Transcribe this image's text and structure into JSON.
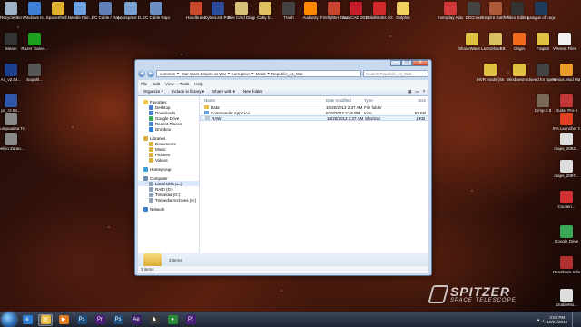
{
  "desktop_icons": [
    {
      "label": "Recycle Bin",
      "color": "#9fb3c8"
    },
    {
      "label": "Windows Is...",
      "color": "#3d7fd6"
    },
    {
      "label": "SpaceShell...",
      "color": "#e0b030"
    },
    {
      "label": "Needle Fair...",
      "color": "#6aa0e0"
    },
    {
      "label": "EC Cable / Rapunz Edit...",
      "color": "#5f7fb5"
    },
    {
      "label": "Aerospace D... Modems 3.7",
      "color": "#7aa0d0"
    },
    {
      "label": "EC Cable Rapunz BGM",
      "color": "#6c8fc0"
    },
    {
      "label": "Handbrake",
      "color": "#c84a2a"
    },
    {
      "label": "CyberLink PowerDVD 12",
      "color": "#2a4a9a"
    },
    {
      "label": "Eve Card Diagram",
      "color": "#d8c27a"
    },
    {
      "label": "Catty b...",
      "color": "#e0c060"
    },
    {
      "label": "Trash",
      "color": "#444"
    },
    {
      "label": "Audacity",
      "color": "#ff8a00"
    },
    {
      "label": "Firefighter Download...",
      "color": "#c6462f"
    },
    {
      "label": "AutoCAD 2013 - Eng...",
      "color": "#c41e2b"
    },
    {
      "label": "SolidWorks 2013 x64...",
      "color": "#d22a2a"
    },
    {
      "label": "Dolphin",
      "color": "#f0d060"
    },
    {
      "label": "Everyday Ajax",
      "color": "#d23a3a"
    },
    {
      "label": "DDO.exe",
      "color": "#444"
    },
    {
      "label": "Empire Earth The Art of C...",
      "color": "#b0583a"
    },
    {
      "label": "Video Editing",
      "color": "#333"
    },
    {
      "label": "League of Legends",
      "color": "#1f3a5a"
    },
    {
      "label": "Steam",
      "color": "#333"
    },
    {
      "label": "Razer Game...",
      "color": "#1da01d"
    },
    {
      "label": "ShockWave Launcher",
      "color": "#e0c040"
    },
    {
      "label": "DxSlowBB",
      "color": "#d8c060"
    },
    {
      "label": "Origin",
      "color": "#f26a1b"
    },
    {
      "label": "Frape2",
      "color": "#e0c040"
    },
    {
      "label": "Veteran Files",
      "color": "#f0f0f0"
    },
    {
      "label": "Ac_v2.54...",
      "color": "#1b3f8c"
    },
    {
      "label": "Sopahl...",
      "color": "#555"
    },
    {
      "label": "MVR mods (Steam)",
      "color": "#e0c040"
    },
    {
      "label": "Windowsmo...",
      "color": "#e0c040"
    },
    {
      "label": "Need for Speed Shi...",
      "color": "#444"
    },
    {
      "label": "Nexus Mod Manager",
      "color": "#e89a2a"
    },
    {
      "label": "pc_r2.54...",
      "color": "#3058a8"
    },
    {
      "label": "Cumpuadsa Tracking",
      "color": "#888"
    },
    {
      "label": "Gimp-2.8",
      "color": "#7a6a55"
    },
    {
      "label": "Guitar Pro 6",
      "color": "#c23838"
    },
    {
      "label": "IFA Launcher Gen",
      "color": "#e04020"
    },
    {
      "label": "Delcio Zaran...",
      "color": "#888"
    },
    {
      "label": "maps_2053...",
      "color": "#ddd"
    },
    {
      "label": "maps_2097...",
      "color": "#ddd"
    },
    {
      "label": "Coolieri...",
      "color": "#d03030"
    },
    {
      "label": "Google Drive",
      "color": "#3aa757"
    },
    {
      "label": "ResShock Infinite",
      "color": "#b03030"
    },
    {
      "label": "EnableMo...",
      "color": "#ddd"
    }
  ],
  "window": {
    "close": "X",
    "maximize": "□",
    "minimize": "_",
    "back": "◀",
    "forward": "▶",
    "breadcrumb": [
      "common",
      "Star Wars Empire at War",
      "corruption",
      "Mods",
      "Republic_At_War"
    ],
    "search_placeholder": "Search Republic_At_War",
    "menu": [
      "File",
      "Edit",
      "View",
      "Tools",
      "Help"
    ],
    "toolbar": [
      "Organize ▾",
      "Include in library ▾",
      "Share with ▾",
      "New folder"
    ],
    "navigation": [
      {
        "label": "Favorites",
        "sub": false,
        "color": "#f3c845",
        "group": false,
        "sel": false
      },
      {
        "label": "Desktop",
        "sub": true,
        "color": "#4a7fcf",
        "group": false,
        "sel": false
      },
      {
        "label": "Downloads",
        "sub": true,
        "color": "#4a7fcf",
        "group": false,
        "sel": false
      },
      {
        "label": "Google Drive",
        "sub": true,
        "color": "#3aa757",
        "group": false,
        "sel": false
      },
      {
        "label": "Recent Places",
        "sub": true,
        "color": "#4a7fcf",
        "group": false,
        "sel": false
      },
      {
        "label": "Dropbox",
        "sub": true,
        "color": "#2a7fe0",
        "group": false,
        "sel": false
      },
      {
        "label": "Libraries",
        "sub": false,
        "color": "#d8b040",
        "group": true,
        "sel": false
      },
      {
        "label": "Documents",
        "sub": true,
        "color": "#d8b040",
        "group": false,
        "sel": false
      },
      {
        "label": "Music",
        "sub": true,
        "color": "#d8b040",
        "group": false,
        "sel": false
      },
      {
        "label": "Pictures",
        "sub": true,
        "color": "#d8b040",
        "group": false,
        "sel": false
      },
      {
        "label": "Videos",
        "sub": true,
        "color": "#d8b040",
        "group": false,
        "sel": false
      },
      {
        "label": "Homegroup",
        "sub": false,
        "color": "#3aa0d8",
        "group": true,
        "sel": false
      },
      {
        "label": "Computer",
        "sub": false,
        "color": "#6f8db3",
        "group": true,
        "sel": false
      },
      {
        "label": "Local Disk (C:)",
        "sub": true,
        "color": "#8f9fb5",
        "group": false,
        "sel": true
      },
      {
        "label": "RAID (D:)",
        "sub": true,
        "color": "#8f9fb5",
        "group": false,
        "sel": false
      },
      {
        "label": "Timpedia (G:)",
        "sub": true,
        "color": "#8f9fb5",
        "group": false,
        "sel": false
      },
      {
        "label": "Timpedia Archives (H:)",
        "sub": true,
        "color": "#8f9fb5",
        "group": false,
        "sel": false
      },
      {
        "label": "Network",
        "sub": false,
        "color": "#3a7fd0",
        "group": true,
        "sel": false
      }
    ],
    "columns": {
      "name": "Name",
      "date": "Date modified",
      "type": "Type",
      "size": "Size"
    },
    "files": [
      {
        "name": "Data",
        "date": "10/20/2013 2:37 AM",
        "type": "File folder",
        "size": "",
        "icon": "#e8c24a",
        "sel": false
      },
      {
        "name": "Commander Apps.ico",
        "date": "5/18/2012 2:45 PM",
        "type": "Icon",
        "size": "67 KB",
        "icon": "#6aa0e0",
        "sel": false
      },
      {
        "name": "RAW",
        "date": "10/20/2013 2:37 AM",
        "type": "Shortcut",
        "size": "1 KB",
        "icon": "#c0c8d4",
        "sel": true
      }
    ],
    "details_text": "3 items",
    "status_text": "3 items"
  },
  "spitzer": {
    "title": "SPITZER",
    "subtitle": "SPACE TELESCOPE"
  },
  "taskbar": {
    "items": [
      {
        "glyph": "e",
        "color": "#2e7fd8",
        "active": false
      },
      {
        "glyph": "▤",
        "color": "#e8b840",
        "active": true
      },
      {
        "glyph": "▶",
        "color": "#e07a1e",
        "active": false
      },
      {
        "glyph": "Ps",
        "color": "#1b4b7a",
        "active": false
      },
      {
        "glyph": "Pr",
        "color": "#4a1b7a",
        "active": false
      },
      {
        "glyph": "Ps",
        "color": "#1b4b7a",
        "active": false
      },
      {
        "glyph": "Ae",
        "color": "#3a1b6a",
        "active": false
      },
      {
        "glyph": "♞",
        "color": "#3a3a3a",
        "active": false
      },
      {
        "glyph": "●",
        "color": "#2a8a3a",
        "active": false
      },
      {
        "glyph": "Pr",
        "color": "#4a1b7a",
        "active": false
      }
    ],
    "time": "3:08 PM",
    "date": "10/21/2013"
  }
}
